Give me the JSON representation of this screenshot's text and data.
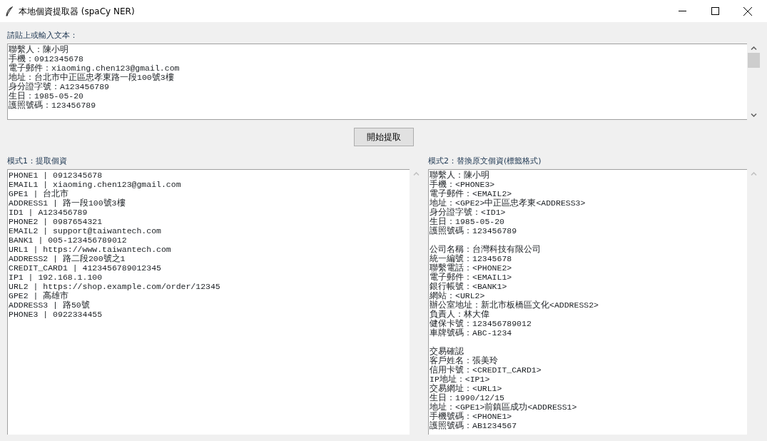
{
  "window": {
    "title": "本地個資提取器 (spaCy NER)"
  },
  "input": {
    "label": "請貼上或輸入文本：",
    "lines": [
      "聯繫人：陳小明",
      "手機：0912345678",
      "電子郵件：xiaoming.chen123@gmail.com",
      "地址：台北市中正區忠孝東路一段100號3樓",
      "身分證字號：A123456789",
      "生日：1985-05-20",
      "護照號碼：123456789"
    ]
  },
  "extract_button": "開始提取",
  "mode1": {
    "label": "模式1：提取個資",
    "lines": [
      "PHONE1 | 0912345678",
      "EMAIL1 | xiaoming.chen123@gmail.com",
      "GPE1 | 台北市",
      "ADDRESS1 | 路一段100號3樓",
      "ID1 | A123456789",
      "PHONE2 | 0987654321",
      "EMAIL2 | support@taiwantech.com",
      "BANK1 | 005-123456789012",
      "URL1 | https://www.taiwantech.com",
      "ADDRESS2 | 路二段200號之1",
      "CREDIT_CARD1 | 4123456789012345",
      "IP1 | 192.168.1.100",
      "URL2 | https://shop.example.com/order/12345",
      "GPE2 | 高雄市",
      "ADDRESS3 | 路50號",
      "PHONE3 | 0922334455"
    ]
  },
  "mode2": {
    "label": "模式2：替換原文個資(標籤格式)",
    "paragraphs": [
      {
        "lines": [
          "聯繫人：陳小明",
          "手機：<PHONE3>",
          "電子郵件：<EMAIL2>",
          "地址：<GPE2>中正區忠孝東<ADDRESS3>",
          "身分證字號：<ID1>",
          "生日：1985-05-20",
          "護照號碼：123456789"
        ]
      },
      {
        "lines": [
          "公司名稱：台灣科技有限公司",
          "統一編號：12345678",
          "聯繫電話：<PHONE2>",
          "電子郵件：<EMAIL1>",
          "銀行帳號：<BANK1>",
          "網站：<URL2>",
          "辦公室地址：新北市板橋區文化<ADDRESS2>",
          "負責人：林大偉",
          "健保卡號：123456789012",
          "車牌號碼：ABC-1234"
        ]
      },
      {
        "lines": [
          "交易確認",
          "客戶姓名：張美玲",
          "信用卡號：<CREDIT_CARD1>",
          "IP地址：<IP1>",
          "交易網址：<URL1>",
          "生日：1990/12/15",
          "地址：<GPE1>前鎮區成功<ADDRESS1>",
          "手機號碼：<PHONE1>",
          "護照號碼：AB1234567"
        ]
      }
    ]
  }
}
